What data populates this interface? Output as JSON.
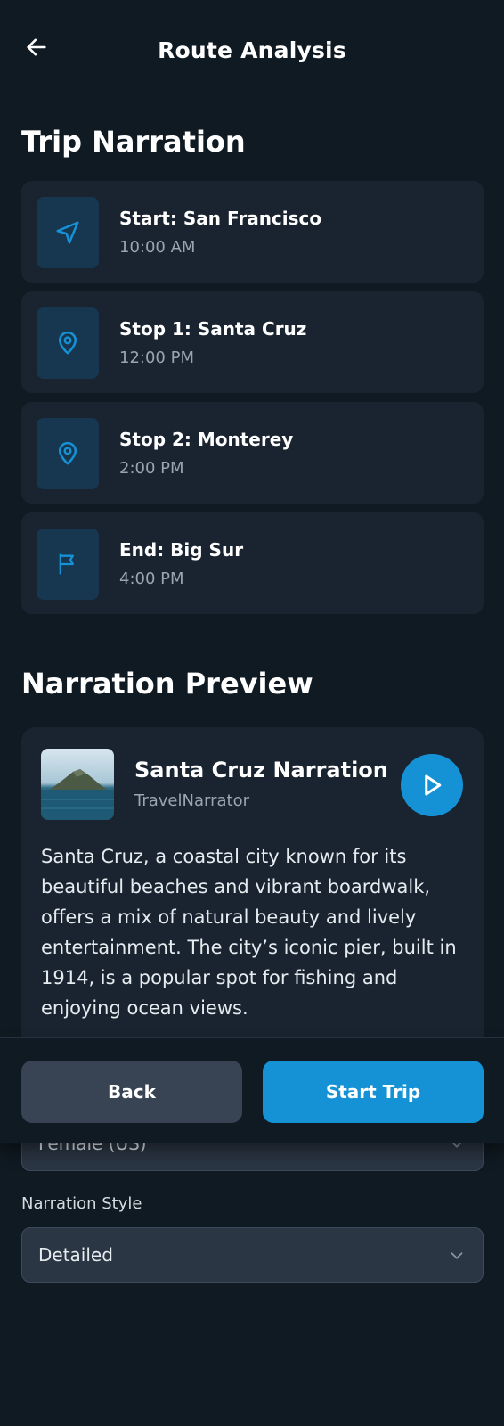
{
  "header": {
    "title": "Route Analysis"
  },
  "trip_narration": {
    "title": "Trip Narration",
    "stops": [
      {
        "title": "Start: San Francisco",
        "time": "10:00 AM",
        "icon": "navigation-arrow-icon"
      },
      {
        "title": "Stop 1: Santa Cruz",
        "time": "12:00 PM",
        "icon": "map-pin-icon"
      },
      {
        "title": "Stop 2: Monterey",
        "time": "2:00 PM",
        "icon": "map-pin-icon"
      },
      {
        "title": "End: Big Sur",
        "time": "4:00 PM",
        "icon": "flag-icon"
      }
    ]
  },
  "narration_preview": {
    "title": "Narration Preview",
    "track_title": "Santa Cruz Narration",
    "author": "TravelNarrator",
    "text": "Santa Cruz, a coastal city known for its beautiful beaches and vibrant boardwalk, offers a mix of natural beauty and lively entertainment. The city’s iconic pier, built in 1914, is a popular spot for fishing and enjoying ocean views."
  },
  "actions": {
    "back_label": "Back",
    "start_label": "Start Trip"
  },
  "settings": {
    "voice_value": "Female (US)",
    "style_label": "Narration Style",
    "style_value": "Detailed"
  },
  "colors": {
    "background": "#101a22",
    "card": "#1a2430",
    "accent": "#1592d6",
    "icon_box": "#173650",
    "secondary_text": "#9aa5b2"
  }
}
